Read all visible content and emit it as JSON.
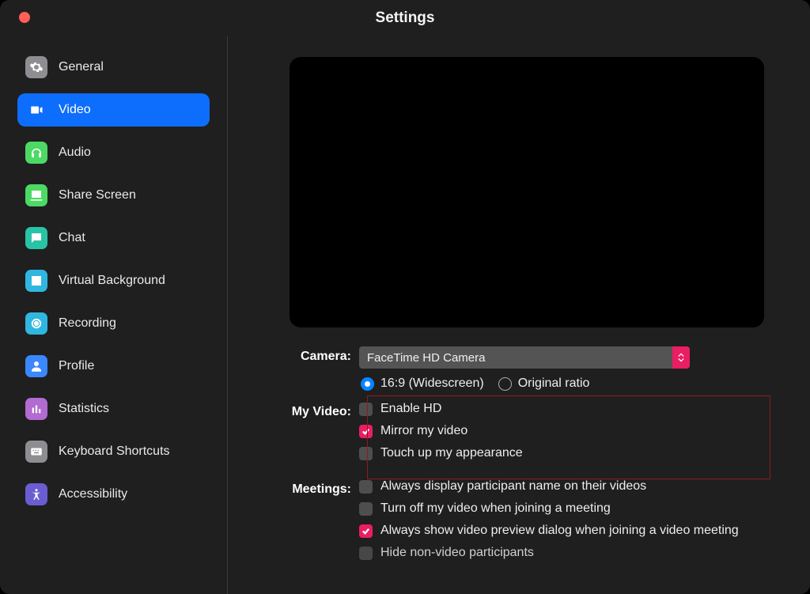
{
  "window": {
    "title": "Settings"
  },
  "sidebar": {
    "items": [
      {
        "key": "general",
        "label": "General"
      },
      {
        "key": "video",
        "label": "Video"
      },
      {
        "key": "audio",
        "label": "Audio"
      },
      {
        "key": "share-screen",
        "label": "Share Screen"
      },
      {
        "key": "chat",
        "label": "Chat"
      },
      {
        "key": "virtual-background",
        "label": "Virtual Background"
      },
      {
        "key": "recording",
        "label": "Recording"
      },
      {
        "key": "profile",
        "label": "Profile"
      },
      {
        "key": "statistics",
        "label": "Statistics"
      },
      {
        "key": "keyboard-shortcuts",
        "label": "Keyboard Shortcuts"
      },
      {
        "key": "accessibility",
        "label": "Accessibility"
      }
    ],
    "active": "video"
  },
  "video": {
    "camera_label": "Camera:",
    "camera_value": "FaceTime HD Camera",
    "ratio_169": "16:9 (Widescreen)",
    "ratio_original": "Original ratio",
    "ratio_selected": "169",
    "myvideo_label": "My Video:",
    "enable_hd": {
      "label": "Enable HD",
      "checked": false
    },
    "mirror": {
      "label": "Mirror my video",
      "checked": true
    },
    "touchup": {
      "label": "Touch up my appearance",
      "checked": false
    },
    "meetings_label": "Meetings:",
    "meetings": [
      {
        "label": "Always display participant name on their videos",
        "checked": false
      },
      {
        "label": "Turn off my video when joining a meeting",
        "checked": false
      },
      {
        "label": "Always show video preview dialog when joining a video meeting",
        "checked": true
      },
      {
        "label": "Hide non-video participants",
        "checked": false
      }
    ]
  },
  "icon_colors": {
    "general": "#8e8e92",
    "video": "#ffffff22",
    "audio": "#4cd964",
    "share-screen": "#4cd964",
    "chat": "#29c3a6",
    "virtual-background": "#2fb7e0",
    "recording": "#2fb7e0",
    "profile": "#3a87ff",
    "statistics": "#b26bd1",
    "keyboard-shortcuts": "#8e8e92",
    "accessibility": "#6a5dd1"
  }
}
